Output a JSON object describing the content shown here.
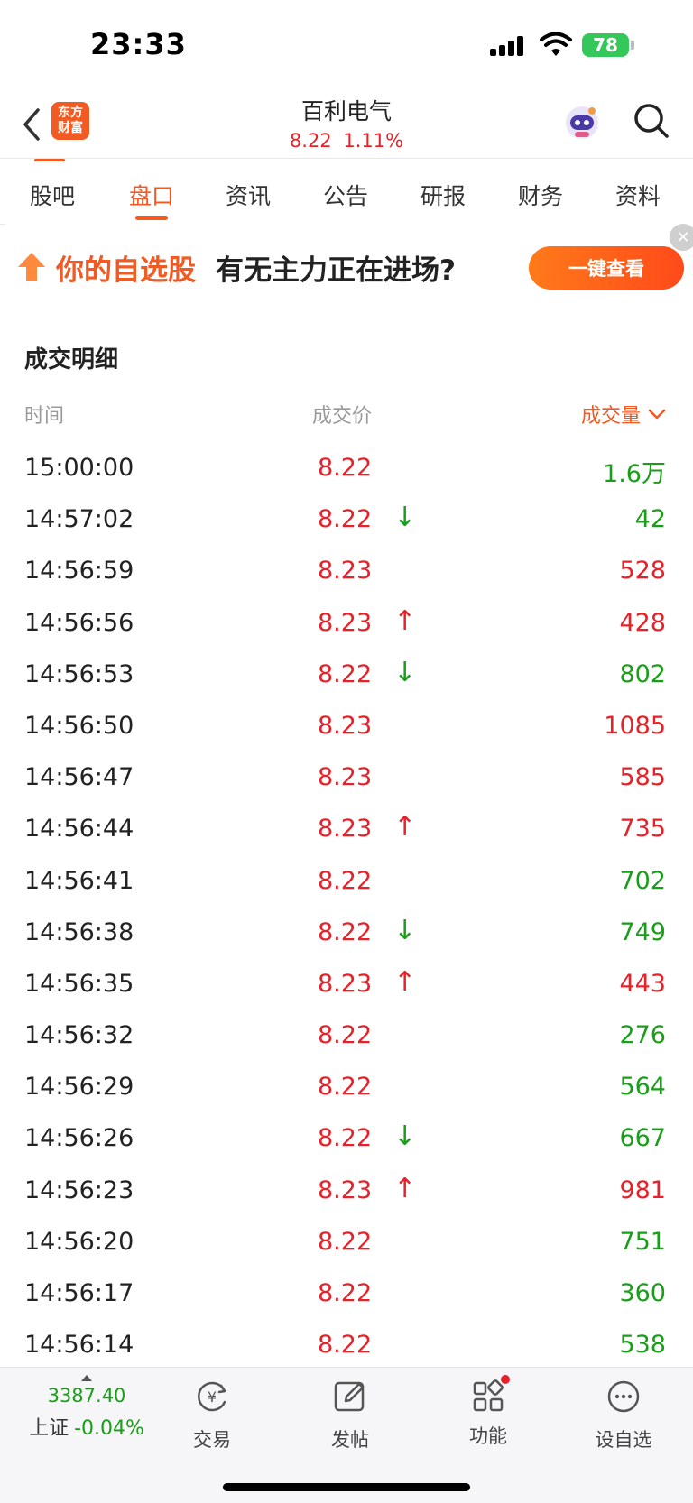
{
  "status_bar": {
    "time": "23:33",
    "battery": "78"
  },
  "header": {
    "logo_line1": "东方",
    "logo_line2": "财富",
    "stock_name": "百利电气",
    "price": "8.22",
    "change_pct": "1.11%"
  },
  "tabs": [
    {
      "label": "股吧",
      "active": false
    },
    {
      "label": "盘口",
      "active": true
    },
    {
      "label": "资讯",
      "active": false
    },
    {
      "label": "公告",
      "active": false
    },
    {
      "label": "研报",
      "active": false
    },
    {
      "label": "财务",
      "active": false
    },
    {
      "label": "资料",
      "active": false
    }
  ],
  "banner": {
    "highlight": "你的自选股",
    "text": "有无主力正在进场?",
    "button": "一键查看",
    "close": "✕"
  },
  "trades": {
    "title": "成交明细",
    "col_time": "时间",
    "col_price": "成交价",
    "col_volume": "成交量",
    "rows": [
      {
        "time": "15:00:00",
        "price": "8.22",
        "arrow": "",
        "volume": "1.6万",
        "vol_color": "green"
      },
      {
        "time": "14:57:02",
        "price": "8.22",
        "arrow": "↓",
        "volume": "42",
        "vol_color": "green"
      },
      {
        "time": "14:56:59",
        "price": "8.23",
        "arrow": "",
        "volume": "528",
        "vol_color": "red"
      },
      {
        "time": "14:56:56",
        "price": "8.23",
        "arrow": "↑",
        "volume": "428",
        "vol_color": "red"
      },
      {
        "time": "14:56:53",
        "price": "8.22",
        "arrow": "↓",
        "volume": "802",
        "vol_color": "green"
      },
      {
        "time": "14:56:50",
        "price": "8.23",
        "arrow": "",
        "volume": "1085",
        "vol_color": "red"
      },
      {
        "time": "14:56:47",
        "price": "8.23",
        "arrow": "",
        "volume": "585",
        "vol_color": "red"
      },
      {
        "time": "14:56:44",
        "price": "8.23",
        "arrow": "↑",
        "volume": "735",
        "vol_color": "red"
      },
      {
        "time": "14:56:41",
        "price": "8.22",
        "arrow": "",
        "volume": "702",
        "vol_color": "green"
      },
      {
        "time": "14:56:38",
        "price": "8.22",
        "arrow": "↓",
        "volume": "749",
        "vol_color": "green"
      },
      {
        "time": "14:56:35",
        "price": "8.23",
        "arrow": "↑",
        "volume": "443",
        "vol_color": "red"
      },
      {
        "time": "14:56:32",
        "price": "8.22",
        "arrow": "",
        "volume": "276",
        "vol_color": "green"
      },
      {
        "time": "14:56:29",
        "price": "8.22",
        "arrow": "",
        "volume": "564",
        "vol_color": "green"
      },
      {
        "time": "14:56:26",
        "price": "8.22",
        "arrow": "↓",
        "volume": "667",
        "vol_color": "green"
      },
      {
        "time": "14:56:23",
        "price": "8.23",
        "arrow": "↑",
        "volume": "981",
        "vol_color": "red"
      },
      {
        "time": "14:56:20",
        "price": "8.22",
        "arrow": "",
        "volume": "751",
        "vol_color": "green"
      },
      {
        "time": "14:56:17",
        "price": "8.22",
        "arrow": "",
        "volume": "360",
        "vol_color": "green"
      },
      {
        "time": "14:56:14",
        "price": "8.22",
        "arrow": "",
        "volume": "538",
        "vol_color": "green"
      }
    ]
  },
  "bottom_nav": {
    "index_value": "3387.40",
    "index_name": "上证",
    "index_change": "-0.04%",
    "items": [
      {
        "label": "交易",
        "icon": "yen-cycle-icon"
      },
      {
        "label": "发帖",
        "icon": "edit-post-icon"
      },
      {
        "label": "功能",
        "icon": "apps-grid-icon"
      },
      {
        "label": "设自选",
        "icon": "more-circle-icon"
      }
    ]
  },
  "colors": {
    "accent": "#f15a22",
    "up": "#e6212a",
    "down": "#1a9e1a"
  }
}
